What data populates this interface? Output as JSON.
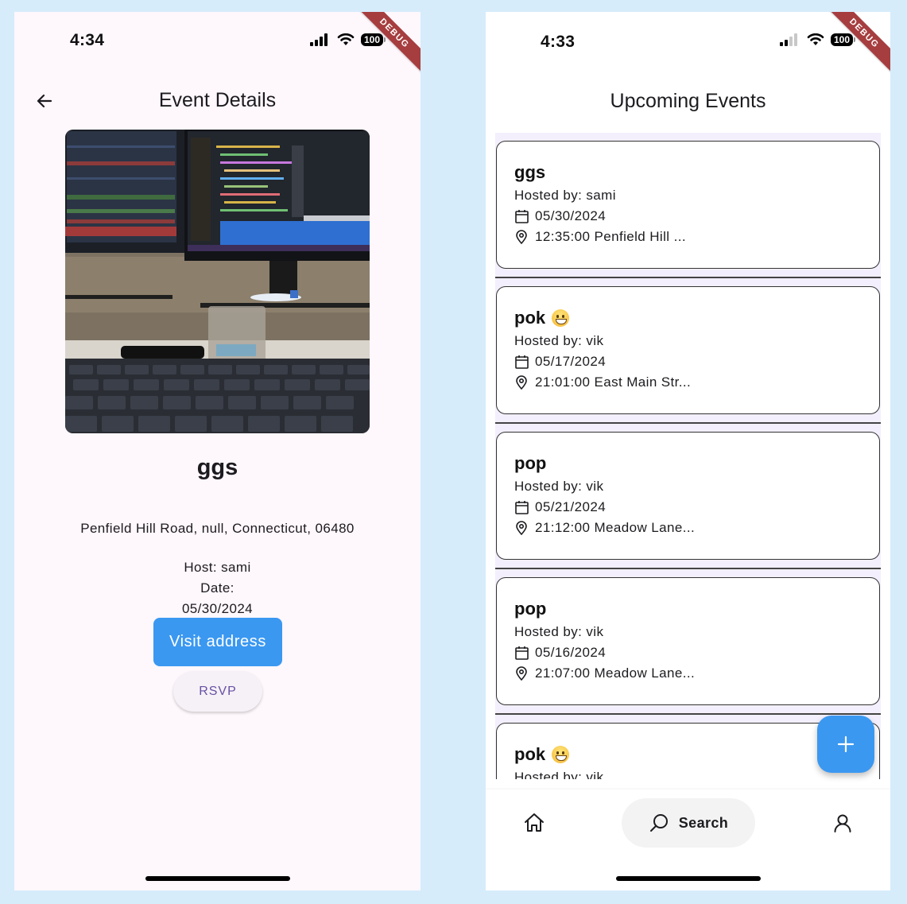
{
  "left_screen": {
    "status_bar": {
      "time": "4:34",
      "battery": "100",
      "debug_banner": "DEBUG"
    },
    "header": {
      "title": "Event Details",
      "back_icon": "arrow-left-icon"
    },
    "event": {
      "image_description": "desk-setup-photo",
      "name": "ggs",
      "address": "Penfield Hill Road, null, Connecticut, 06480",
      "host_line": "Host: sami",
      "date_label": "Date:",
      "date_value": "05/30/2024"
    },
    "actions": {
      "visit_address_label": "Visit address",
      "rsvp_label": "RSVP"
    },
    "colors": {
      "primary": "#3a98f1",
      "rsvp_text": "#6750a4",
      "background": "#fef7fc"
    }
  },
  "right_screen": {
    "status_bar": {
      "time": "4:33",
      "battery": "100",
      "debug_banner": "DEBUG"
    },
    "header": {
      "title": "Upcoming Events"
    },
    "events": [
      {
        "title": "ggs",
        "emoji": false,
        "hosted_by": "Hosted by: sami",
        "date": "05/30/2024",
        "location": "12:35:00 Penfield Hill ..."
      },
      {
        "title": "pok",
        "emoji": true,
        "hosted_by": "Hosted by: vik",
        "date": "05/17/2024",
        "location": "21:01:00 East Main Str..."
      },
      {
        "title": "pop",
        "emoji": false,
        "hosted_by": "Hosted by: vik",
        "date": "05/21/2024",
        "location": "21:12:00 Meadow Lane..."
      },
      {
        "title": "pop",
        "emoji": false,
        "hosted_by": "Hosted by: vik",
        "date": "05/16/2024",
        "location": "21:07:00 Meadow Lane..."
      },
      {
        "title": "pok",
        "emoji": true,
        "hosted_by": "Hosted by: vik",
        "date": "",
        "location": ""
      }
    ],
    "fab": {
      "icon": "plus-icon"
    },
    "bottom_nav": {
      "items": [
        {
          "icon": "home-icon",
          "label": ""
        },
        {
          "icon": "search-icon",
          "label": "Search",
          "selected": true
        },
        {
          "icon": "profile-icon",
          "label": ""
        }
      ]
    },
    "colors": {
      "primary": "#3a98f1",
      "list_background": "#f3effc"
    }
  }
}
